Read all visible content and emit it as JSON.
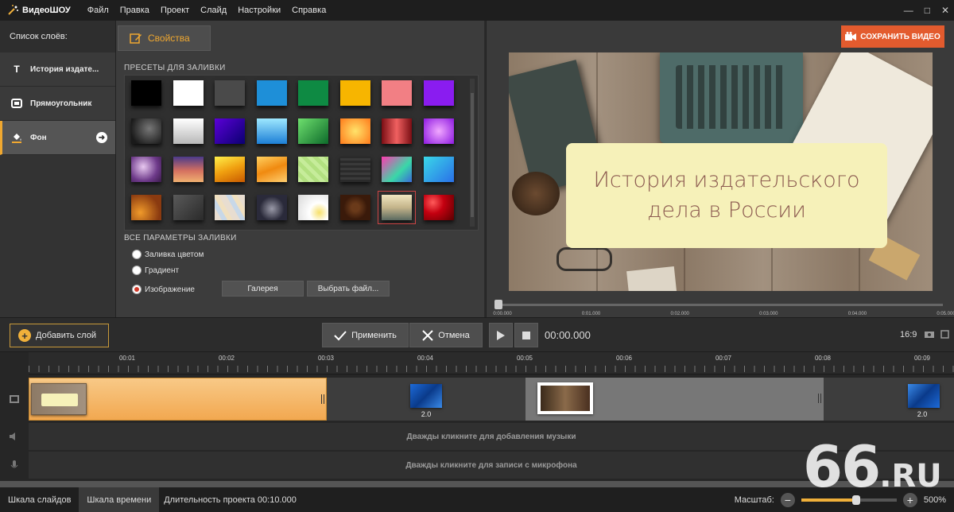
{
  "app": {
    "name": "ВидеоШОУ"
  },
  "menu": [
    "Файл",
    "Правка",
    "Проект",
    "Слайд",
    "Настройки",
    "Справка"
  ],
  "window_controls": [
    "—",
    "□",
    "✕"
  ],
  "layers_panel": {
    "title": "Список слоёв:",
    "items": [
      {
        "label": "История издате...",
        "icon": "text-icon"
      },
      {
        "label": "Прямоугольник",
        "icon": "rectangle-icon"
      },
      {
        "label": "Фон",
        "icon": "fill-bucket-icon",
        "active": true
      }
    ]
  },
  "properties": {
    "tab_label": "Свойства",
    "presets_title": "ПРЕСЕТЫ ДЛЯ ЗАЛИВКИ",
    "presets": [
      "#000000",
      "#ffffff",
      "#4a4a4a",
      "#1e8fd8",
      "#0e8a43",
      "#f7b500",
      "#f27f84",
      "#8a1cf0",
      "radial-gradient(circle at 60% 40%, #777 0%, #1a1a1a 80%)",
      "linear-gradient(180deg, #ffffff 0%, #b8b8b8 100%)",
      "linear-gradient(135deg, #5b00d8 0%, #0a0070 100%)",
      "linear-gradient(180deg, #9ee8ff 0%, #1d7fd6 100%)",
      "linear-gradient(135deg, #6ee06e 0%, #0d6a2a 100%)",
      "radial-gradient(circle at 50% 50%, #ffe36a 0%, #ff7a1a 100%)",
      "linear-gradient(90deg, #7a0e14 0%, #f06060 50%, #7a0e14 100%)",
      "radial-gradient(circle at 50% 50%, #f1a8ff 0%, #8d18e0 100%)",
      "radial-gradient(circle at 40% 40%, #e8c8f0 0%, #6e3a8a 60%, #3a1a4a 100%)",
      "linear-gradient(180deg, #4a3a8a 0%, #d47060 55%, #f0b070 100%)",
      "linear-gradient(160deg, #fff04a 0%, #f0a010 50%, #c85a00 100%)",
      "linear-gradient(160deg, #ffd060 0%, #f08a10 50%, #ffcf70 100%)",
      "repeating-linear-gradient(45deg, #c6ec9a 0 5px, #b2e080 5px 10px)",
      "repeating-linear-gradient(0deg, #2a2a2a 0 3px, #3a3a3a 3px 6px)",
      "linear-gradient(135deg, #ff3ab0 0%, #3ad8a8 60%, #3a6ad8 100%)",
      "linear-gradient(135deg, #3ad8e8 0%, #2a70e8 100%)",
      "radial-gradient(circle at 30% 70%, #f09a2a 0%, #8a3a10 70%)",
      "linear-gradient(135deg, #5a5a5a 0%, #2a2a2a 100%)",
      "repeating-linear-gradient(60deg, #e8ddd0 0 8px, #c8d8e8 8px 14px, #f0e0c0 14px 20px)",
      "radial-gradient(circle at 50% 55%, #9a9aa8 0%, #2a2a3a 60%)",
      "radial-gradient(circle at 70% 70%, #f7e06a 0%, #ffffff 35%, #d8d8d8 100%)",
      "radial-gradient(circle, #6a3a1a 20%, #3a1a0a 60%)",
      "linear-gradient(180deg, #f0e6c0 0%, #c4b48a 50%, #5a6a60 100%)",
      "radial-gradient(circle at 30% 30%, #ff5a5a 0%, #c40010 40%, #5a0000 100%)"
    ],
    "selected_preset_index": 30,
    "fill_params_title": "ВСЕ ПАРАМЕТРЫ ЗАЛИВКИ",
    "fill_options": [
      {
        "label": "Заливка цветом",
        "checked": false
      },
      {
        "label": "Градиент",
        "checked": false
      },
      {
        "label": "Изображение",
        "checked": true
      }
    ],
    "gallery_button": "Галерея",
    "choose_file_button": "Выбрать файл..."
  },
  "preview": {
    "save_button": "СОХРАНИТЬ ВИДЕО",
    "title_line1": "История издательского",
    "title_line2": "дела в России",
    "ruler_ticks": [
      "0:00.000",
      "0:01.000",
      "0:02.000",
      "0:03.000",
      "0:04.000",
      "0:05.000"
    ],
    "playhead_position": 0
  },
  "toolbar": {
    "add_layer": "Добавить слой",
    "apply": "Применить",
    "cancel": "Отмена",
    "timecode": "00:00.000",
    "aspect_ratio": "16:9"
  },
  "timeline": {
    "ruler_labels": [
      "00:01",
      "00:02",
      "00:03",
      "00:04",
      "00:05",
      "00:06",
      "00:07",
      "00:08",
      "00:09"
    ],
    "transition_duration_1": "2.0",
    "transition_duration_2": "2.0",
    "music_hint": "Дважды кликните для добавления музыки",
    "mic_hint": "Дважды кликните для записи с микрофона"
  },
  "statusbar": {
    "tab_slides": "Шкала слайдов",
    "tab_timeline": "Шкала времени",
    "duration": "Длительность проекта 00:10.000",
    "zoom_label": "Масштаб:",
    "zoom_value": "500%",
    "zoom_level": 0.58
  },
  "watermark": {
    "number": "66",
    "domain": ".RU"
  },
  "colors": {
    "accent": "#f0a830",
    "save": "#e35b2e",
    "clip": "#f2a850"
  }
}
